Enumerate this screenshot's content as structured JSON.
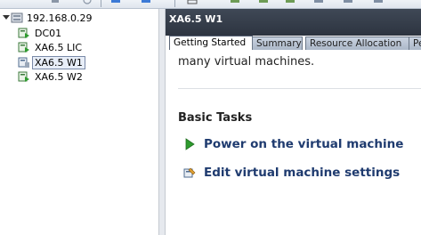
{
  "tree": {
    "root": "192.168.0.29",
    "items": [
      "DC01",
      "XA6.5 LIC",
      "XA6.5 W1",
      "XA6.5 W2"
    ],
    "selected": "XA6.5 W1"
  },
  "panel": {
    "title": "XA6.5 W1",
    "tabs": [
      "Getting Started",
      "Summary",
      "Resource Allocation",
      "Pe"
    ],
    "active_tab": "Getting Started",
    "intro_text": "many virtual machines.",
    "section_title": "Basic Tasks",
    "tasks": [
      {
        "label": "Power on the virtual machine",
        "icon": "play-icon"
      },
      {
        "label": "Edit virtual machine settings",
        "icon": "edit-settings-icon"
      }
    ]
  },
  "colors": {
    "header_bg": "#353d4a",
    "task_link": "#1f3b6f",
    "play_green": "#2e9b2e"
  }
}
